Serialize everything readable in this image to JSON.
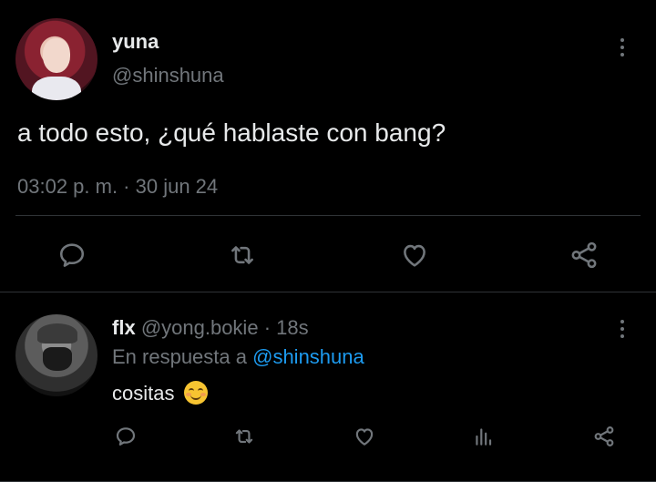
{
  "main_tweet": {
    "display_name": "yuna",
    "handle": "@shinshuna",
    "text": "a todo esto, ¿qué hablaste con bang?",
    "timestamp": "03:02 p. m. · 30 jun 24",
    "actions": [
      "reply-icon",
      "retweet-icon",
      "like-icon",
      "share-icon"
    ]
  },
  "reply_tweet": {
    "display_name": "flx",
    "handle": "@yong.bokie",
    "age": "· 18s",
    "reply_prefix": "En respuesta a",
    "reply_mention": "@shinshuna",
    "text": "cositas",
    "emoji": "😊",
    "actions": [
      "reply-icon",
      "retweet-icon",
      "like-icon",
      "views-icon",
      "share-icon"
    ]
  },
  "colors": {
    "background": "#000000",
    "text": "#e7e9ea",
    "muted": "#71767b",
    "link": "#1d9bf0",
    "divider": "#2f3336"
  }
}
